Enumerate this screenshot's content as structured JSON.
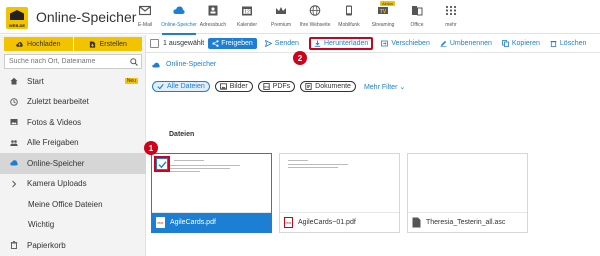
{
  "app": {
    "logo_text": "WEB.DE",
    "title": "Online-Speicher"
  },
  "nav": [
    {
      "label": "E-Mail",
      "icon": "mail-icon"
    },
    {
      "label": "Online-Speicher",
      "icon": "cloud-icon",
      "active": true
    },
    {
      "label": "Adressbuch",
      "icon": "address-book-icon"
    },
    {
      "label": "Kalender",
      "icon": "calendar-icon"
    },
    {
      "label": "Premium",
      "icon": "crown-icon"
    },
    {
      "label": "Ihre Webseite",
      "icon": "globe-icon"
    },
    {
      "label": "Mobilfunk",
      "icon": "phone-icon"
    },
    {
      "label": "Streaming",
      "icon": "tv-icon",
      "badge": "Aktion"
    },
    {
      "label": "Office",
      "icon": "office-icon"
    },
    {
      "label": "mehr",
      "icon": "grid-icon"
    }
  ],
  "sidebar": {
    "upload_label": "Hochladen",
    "create_label": "Erstellen",
    "search_placeholder": "Suche nach Ort, Dateiname",
    "items": [
      {
        "label": "Start",
        "icon": "home-icon",
        "badge": "Neu"
      },
      {
        "label": "Zuletzt bearbeitet",
        "icon": "clock-icon"
      },
      {
        "label": "Fotos & Videos",
        "icon": "image-icon"
      },
      {
        "label": "Alle Freigaben",
        "icon": "users-icon"
      },
      {
        "label": "Online-Speicher",
        "icon": "cloud-icon",
        "active": true
      },
      {
        "label": "Kamera Uploads",
        "icon": "chevron-right-icon"
      },
      {
        "label": "Meine Office Dateien",
        "sub": true
      },
      {
        "label": "Wichtig",
        "sub": true
      },
      {
        "label": "Papierkorb",
        "icon": "trash-icon"
      }
    ]
  },
  "toolbar": {
    "selected_count": "1 ausgewählt",
    "share": "Freigeben",
    "send": "Senden",
    "download": "Herunterladen",
    "move": "Verschieben",
    "rename": "Umbenennen",
    "copy": "Kopieren",
    "delete": "Löschen"
  },
  "main": {
    "breadcrumb": "Online-Speicher",
    "filters": {
      "all": "Alle Dateien",
      "images": "Bilder",
      "pdfs": "PDFs",
      "documents": "Dokumente",
      "more": "Mehr Filter"
    },
    "section_title": "Dateien",
    "files": [
      {
        "name": "AgileCards.pdf",
        "selected": true
      },
      {
        "name": "AgileCards~01.pdf",
        "selected": false
      },
      {
        "name": "Theresia_Testerin_all.asc",
        "selected": false
      }
    ]
  },
  "callouts": {
    "step1": "1",
    "step2": "2"
  },
  "colors": {
    "accent": "#1c7fd4",
    "brand_yellow": "#f3c300",
    "highlight_red": "#d0021b"
  }
}
